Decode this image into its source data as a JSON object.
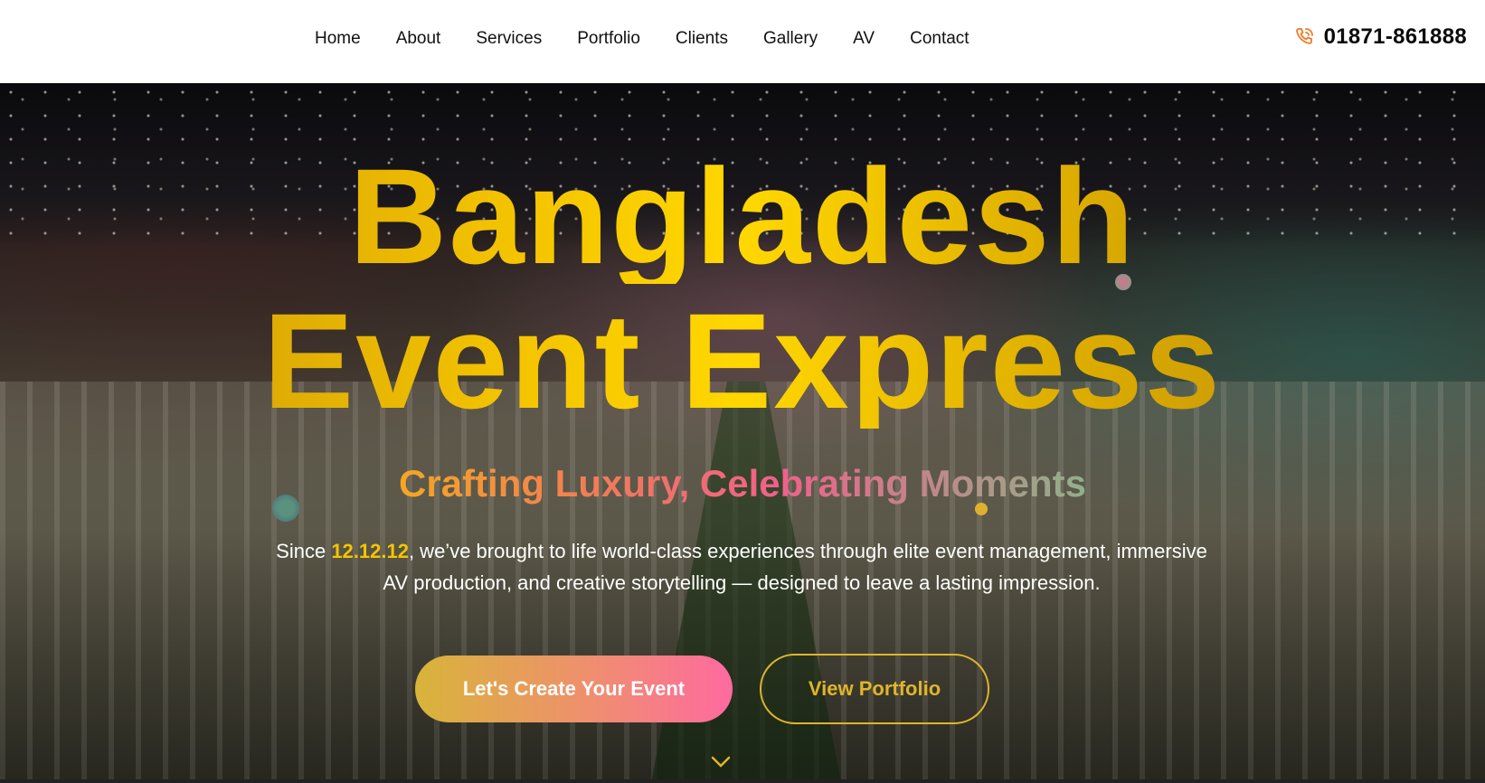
{
  "nav": {
    "links": [
      "Home",
      "About",
      "Services",
      "Portfolio",
      "Clients",
      "Gallery",
      "AV",
      "Contact"
    ],
    "phone": "01871-861888",
    "phone_icon": "phone-icon"
  },
  "hero": {
    "title_line1": "Bangladesh",
    "title_line2": "Event Express",
    "tagline": "Crafting Luxury, Celebrating Moments",
    "intro_prefix": "Since ",
    "intro_date": "12.12.12",
    "intro_rest": ", we’ve brought to life world-class experiences through elite event management, immersive AV production, and creative storytelling — designed to leave a lasting impression.",
    "primary_cta": "Let's Create Your Event",
    "secondary_cta": "View Portfolio",
    "scroll_icon": "chevron-down-icon"
  },
  "colors": {
    "gold": "#f4c400",
    "accent_pink": "#ff6aa0",
    "button_border": "#e0b52a"
  }
}
